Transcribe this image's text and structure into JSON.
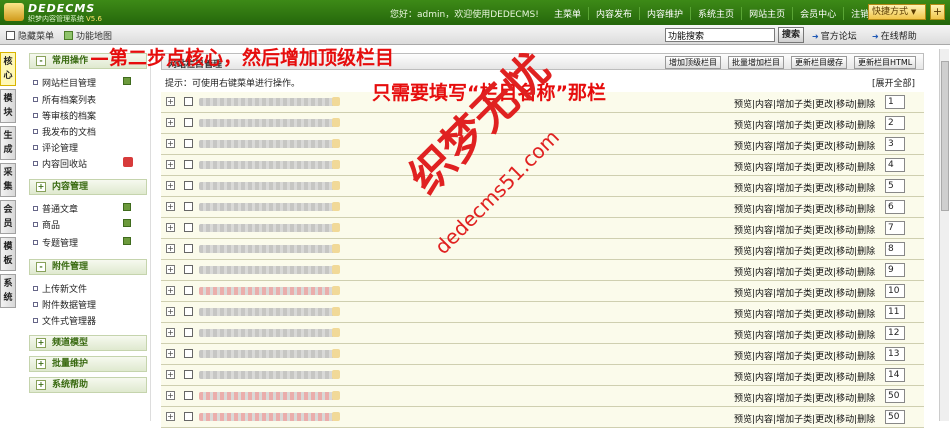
{
  "brand": {
    "name": "DEDECMS",
    "subtitle": "织梦内容管理系统",
    "version": "V5.6"
  },
  "header": {
    "greeting": "您好：admin，欢迎使用DEDECMS!",
    "nav": [
      "主菜单",
      "内容发布",
      "内容维护",
      "系统主页",
      "网站主页",
      "会员中心",
      "注销"
    ],
    "quick_label": "快捷方式",
    "plus_label": "+"
  },
  "subbar": {
    "hide_menu": "隐藏菜单",
    "site_map": "功能地图",
    "search_value": "功能搜索",
    "search_button": "搜索",
    "forum": "官方论坛",
    "help": "在线帮助"
  },
  "vtabs": [
    "核心",
    "模块",
    "生成",
    "采集",
    "会员",
    "模板",
    "系统"
  ],
  "menu": {
    "common_title": "常用操作",
    "common_items": [
      "网站栏目管理",
      "所有档案列表",
      "等审核的档案",
      "我发布的文档",
      "评论管理",
      "内容回收站"
    ],
    "content_title": "内容管理",
    "content_items": [
      "普通文章",
      "商品",
      "专题管理"
    ],
    "attach_title": "附件管理",
    "attach_items": [
      "上传新文件",
      "附件数据管理",
      "文件式管理器"
    ],
    "channel_title": "频道模型",
    "batch_title": "批量维护",
    "help_title": "系统帮助"
  },
  "main": {
    "title": "网站栏目管理",
    "buttons": [
      "增加顶级栏目",
      "批量增加栏目",
      "更新栏目缓存",
      "更新栏目HTML"
    ],
    "tip": "提示：可使用右键菜单进行操作。",
    "expand_all": "[展开全部]",
    "actions": "预览|内容|增加子类|更改|移动|删除",
    "rows": [
      {
        "order": "1",
        "red": false
      },
      {
        "order": "2",
        "red": false
      },
      {
        "order": "3",
        "red": false
      },
      {
        "order": "4",
        "red": false
      },
      {
        "order": "5",
        "red": false
      },
      {
        "order": "6",
        "red": false
      },
      {
        "order": "7",
        "red": false
      },
      {
        "order": "8",
        "red": false
      },
      {
        "order": "9",
        "red": false
      },
      {
        "order": "10",
        "red": true
      },
      {
        "order": "11",
        "red": false
      },
      {
        "order": "12",
        "red": false
      },
      {
        "order": "13",
        "red": false
      },
      {
        "order": "14",
        "red": false
      },
      {
        "order": "50",
        "red": true
      },
      {
        "order": "50",
        "red": true
      }
    ]
  },
  "annotations": {
    "step": "—第二步点核心，然后增加顶级栏目",
    "note": "只需要填写“栏目名称”那栏",
    "watermark": "织梦无忧",
    "watermark_url": "dedecms51.com"
  },
  "colors": {
    "brand_green": "#2f7a12",
    "annot_red": "#e60d0d",
    "row_bg": "#fbfbeb"
  }
}
